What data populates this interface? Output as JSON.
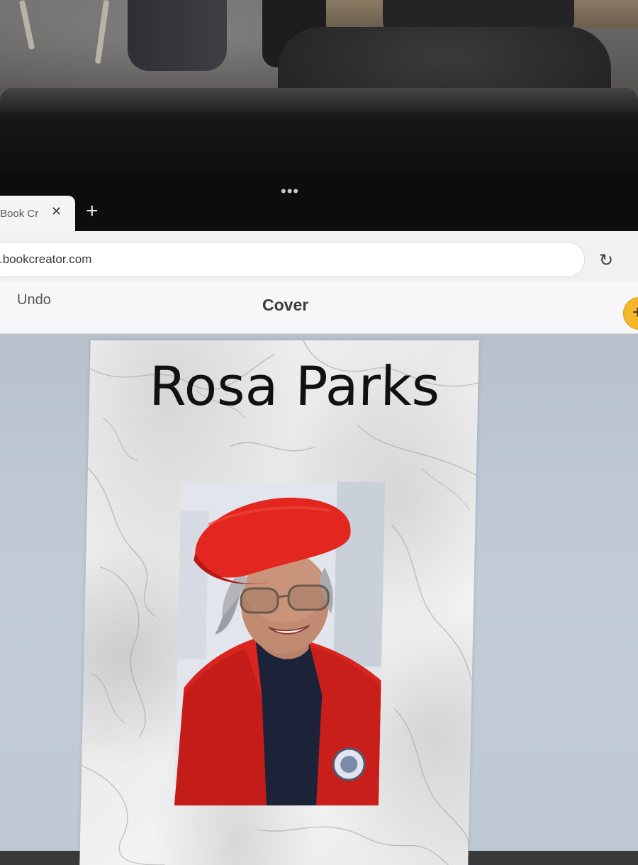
{
  "browser": {
    "tab_title": "Book Cr",
    "close_glyph": "✕",
    "new_tab_glyph": "+",
    "more_glyph": "•••",
    "url": ".bookcreator.com",
    "reload_glyph": "↻"
  },
  "app": {
    "undo_label": "Undo",
    "view_title": "Cover",
    "accent_color": "#f3b72b"
  },
  "book": {
    "cover_title": "Rosa Parks",
    "portrait_icon": "portrait-photo"
  },
  "colors": {
    "canvas_background": "#bfc9d4",
    "hat_and_jacket": "#d9241f"
  }
}
